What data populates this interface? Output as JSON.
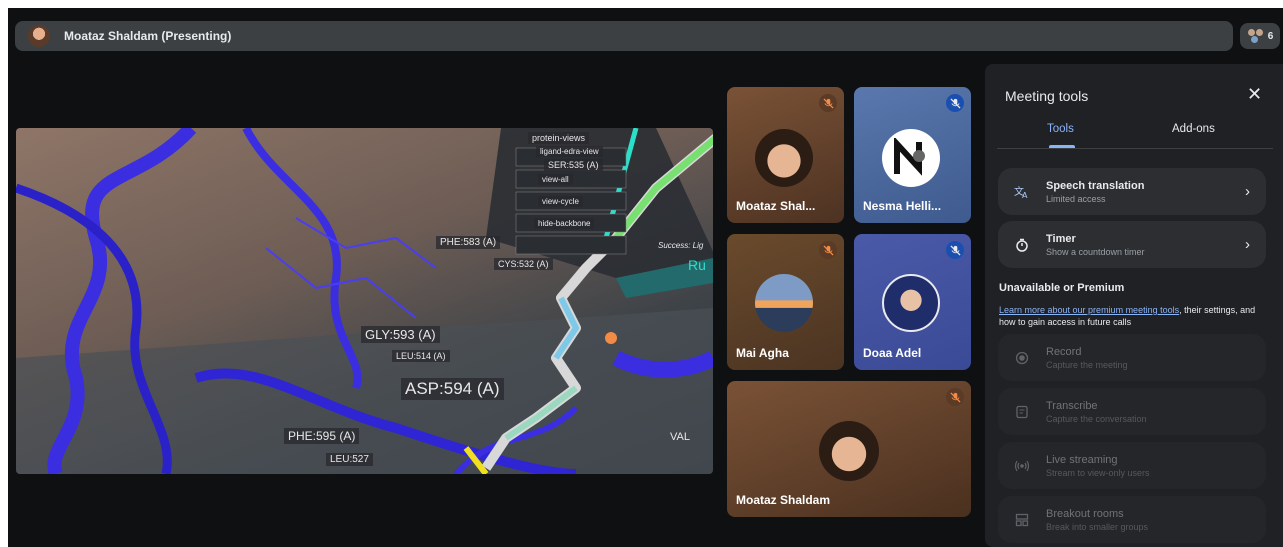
{
  "topbar": {
    "presenter": "Moataz Shaldam (Presenting)",
    "participant_count": "6"
  },
  "shared_screen": {
    "labels": [
      "PHE:583 (A)",
      "CYS:532 (A)",
      "GLY:593 (A)",
      "LEU:514 (A)",
      "ASP:594 (A)",
      "PHE:595 (A)",
      "LEU:527",
      "SER:535 (A)",
      "protein-views",
      "ligand-edra-view",
      "view-all",
      "view-cycle",
      "hide-backbone",
      "Success: Lig",
      "Ru",
      "VAL"
    ]
  },
  "participants": [
    {
      "name": "Moataz Shal...",
      "muted": true
    },
    {
      "name": "Nesma Helli...",
      "muted": true
    },
    {
      "name": "Mai Agha",
      "muted": true
    },
    {
      "name": "Doaa Adel",
      "muted": true
    },
    {
      "name": "Moataz Shaldam",
      "muted": true
    }
  ],
  "panel": {
    "title": "Meeting tools",
    "tabs": [
      {
        "label": "Tools",
        "active": true
      },
      {
        "label": "Add-ons",
        "active": false
      }
    ],
    "tools": [
      {
        "title": "Speech translation",
        "subtitle": "Limited access",
        "icon": "translate-icon"
      },
      {
        "title": "Timer",
        "subtitle": "Show a countdown timer",
        "icon": "timer-icon"
      }
    ],
    "premium_heading": "Unavailable or Premium",
    "premium_link": "Learn more about our premium meeting tools",
    "premium_rest": ", their settings, and how to gain access in future calls",
    "premium_tools": [
      {
        "title": "Record",
        "subtitle": "Capture the meeting",
        "icon": "record-icon"
      },
      {
        "title": "Transcribe",
        "subtitle": "Capture the conversation",
        "icon": "transcribe-icon"
      },
      {
        "title": "Live streaming",
        "subtitle": "Stream to view-only users",
        "icon": "live-stream-icon"
      },
      {
        "title": "Breakout rooms",
        "subtitle": "Break into smaller groups",
        "icon": "breakout-rooms-icon"
      }
    ]
  },
  "colors": {
    "accent": "#8ab4f8",
    "mute_badge_orange": "#f28b45",
    "mute_badge_blue": "#1a73e8"
  }
}
